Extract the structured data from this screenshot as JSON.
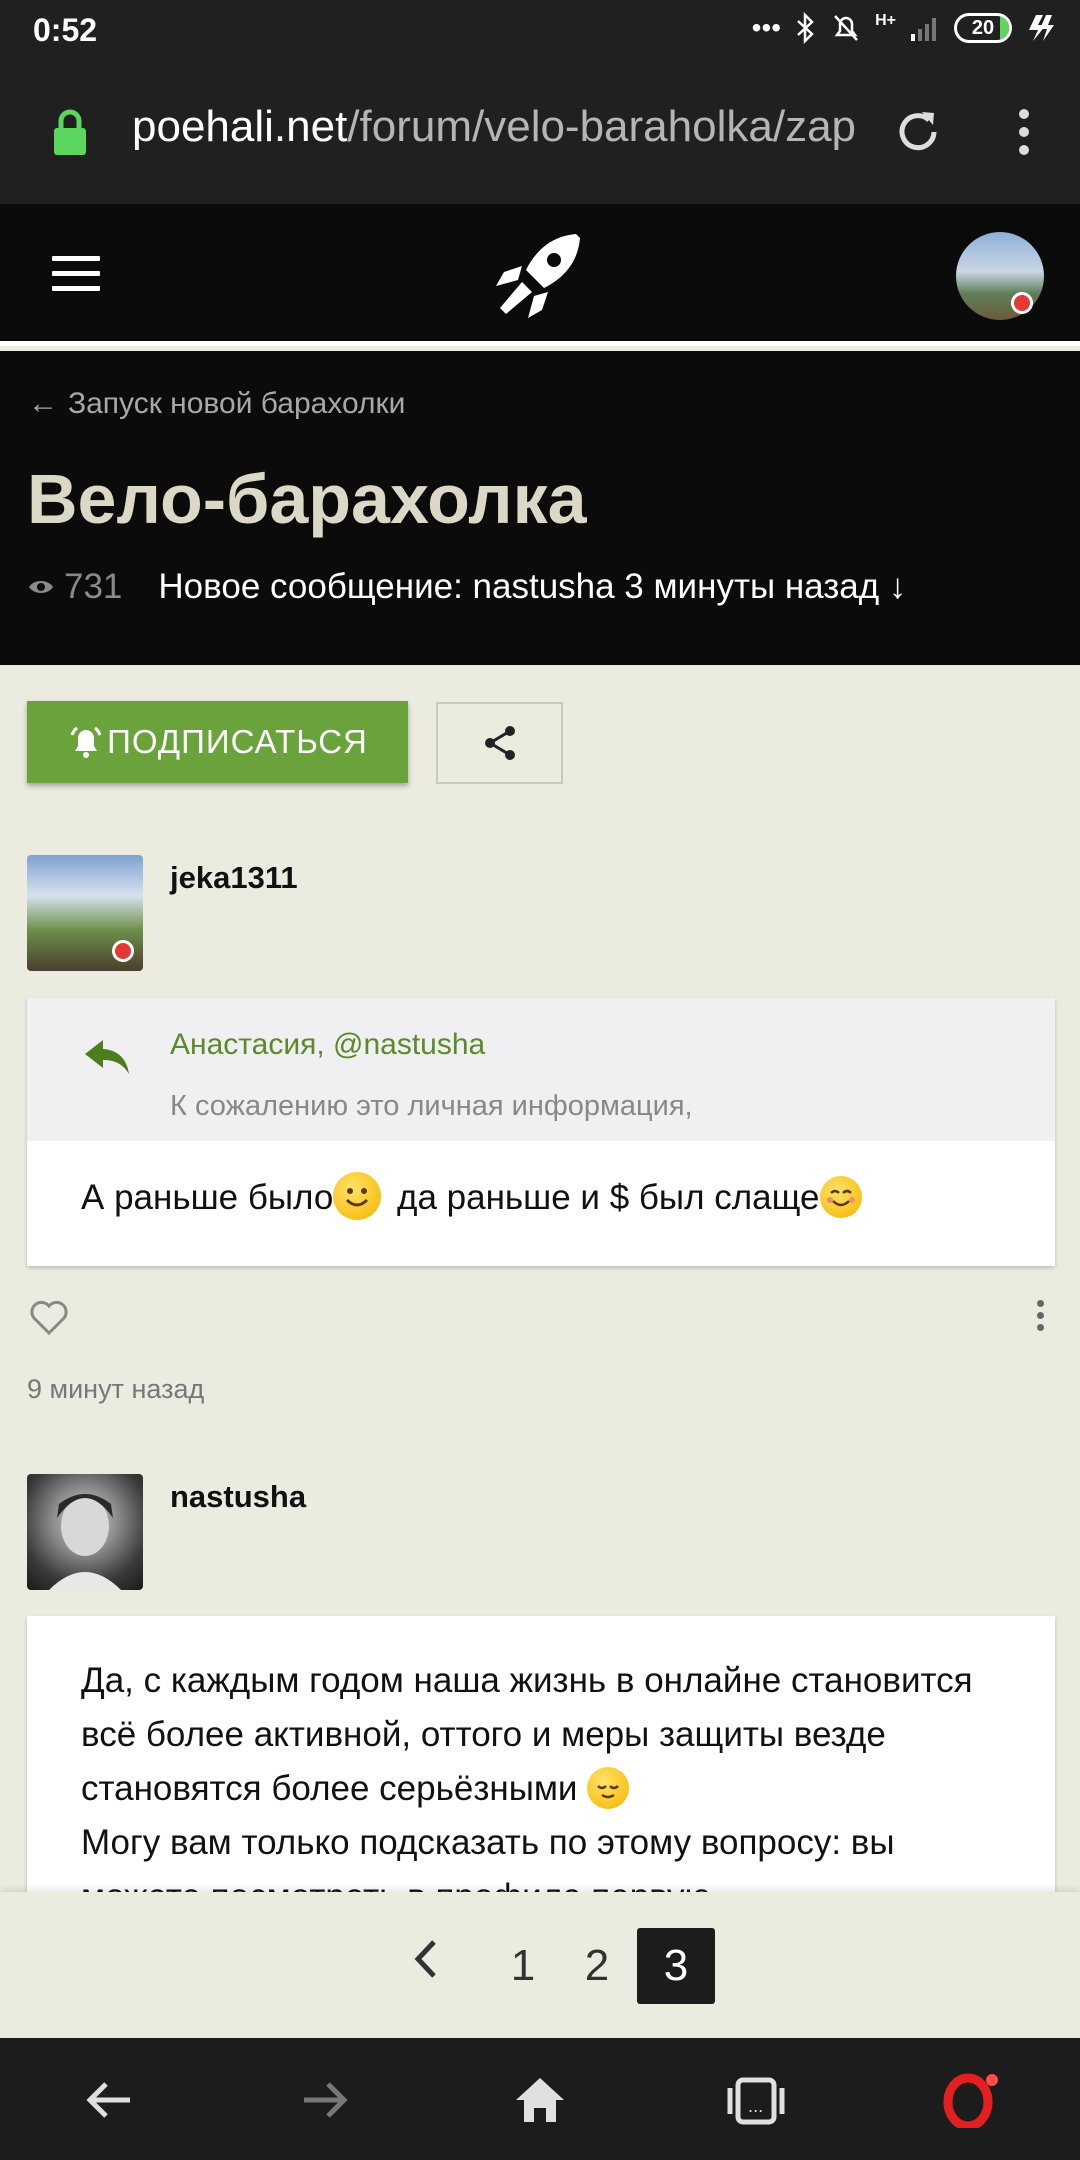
{
  "status_bar": {
    "time": "0:52",
    "network": "H+",
    "battery": "20"
  },
  "browser": {
    "url_host": "poehali.net",
    "url_path": "/forum/velo-baraholka/zapus"
  },
  "topic": {
    "breadcrumb": "Запуск новой барахолки",
    "title": "Вело-барахолка",
    "views": "731",
    "new_message": "Новое сообщение: nastusha 3 минуты назад ↓"
  },
  "buttons": {
    "subscribe": "ПОДПИСАТЬСЯ"
  },
  "posts": [
    {
      "username": "jeka1311",
      "quote_author": "Анастасия, @nastusha",
      "quote_text": "К сожалению это личная информация,",
      "body_part1": "А раньше было",
      "body_part2": " да раньше и $ был слаще",
      "time": "9 минут назад"
    },
    {
      "username": "nastusha",
      "body_part1": "Да, с каждым годом наша жизнь в онлайне становится всё более активной, оттого и меры защиты везде становятся более серьёзными",
      "body_part2": "Могу вам только подсказать по этому вопросу: вы можете посмотреть в профиле первую"
    }
  ],
  "pagination": {
    "pages": [
      "1",
      "2",
      "3"
    ],
    "current": "3"
  },
  "colors": {
    "accent_green": "#6aa33c",
    "header_bg": "#0b0b0b",
    "page_bg": "#ecebe0",
    "online_dot": "#e53935"
  }
}
